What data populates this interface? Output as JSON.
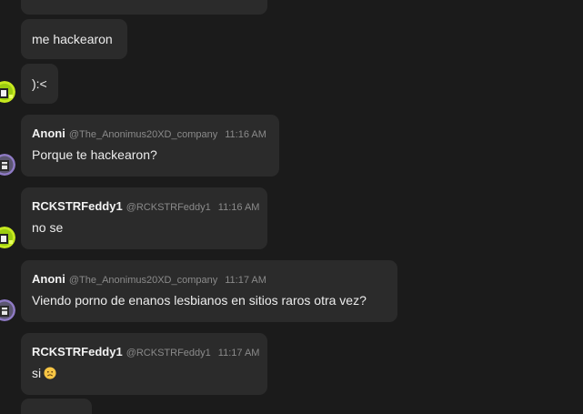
{
  "messages": [
    {
      "text": "me hackearon"
    },
    {
      "text": "):<"
    },
    {
      "author": "Anoni",
      "handle": "@The_Anonimus20XD_company",
      "time": "11:16 AM",
      "text": "Porque te hackearon?"
    },
    {
      "author": "RCKSTRFeddy1",
      "handle": "@RCKSTRFeddy1",
      "time": "11:16 AM",
      "text": "no se"
    },
    {
      "author": "Anoni",
      "handle": "@The_Anonimus20XD_company",
      "time": "11:17 AM",
      "text": "Viendo porno de enanos lesbianos en sitios raros otra vez?"
    },
    {
      "author": "RCKSTRFeddy1",
      "handle": "@RCKSTRFeddy1",
      "time": "11:17 AM",
      "text": "si",
      "emoji": "frowning-face-emoji"
    }
  ],
  "avatars": {
    "rckstrfeddy1": {
      "icon": "green-yellow-avatar",
      "color": "#c6e81f"
    },
    "anoni": {
      "icon": "purple-gray-avatar",
      "color": "#8e7ac4"
    }
  }
}
